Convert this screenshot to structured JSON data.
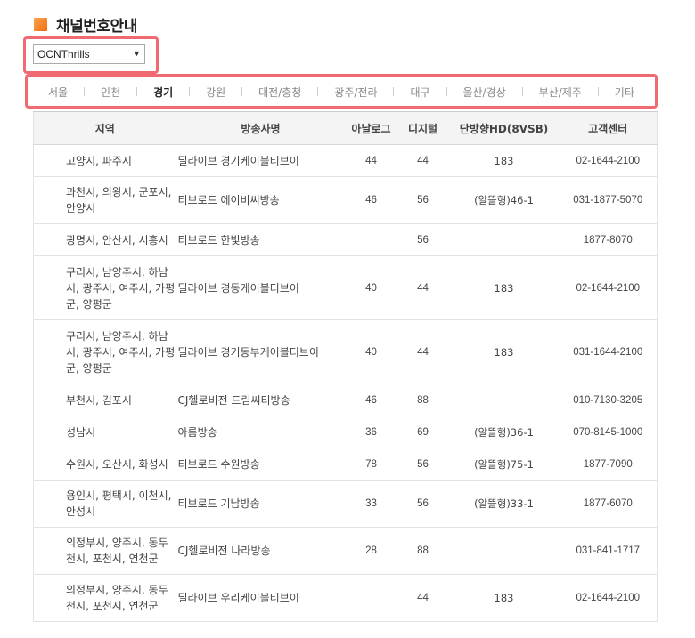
{
  "page": {
    "title": "채널번호안내"
  },
  "channel_select": {
    "selected": "OCNThrills"
  },
  "tabs": [
    {
      "label": "서울",
      "active": false
    },
    {
      "label": "인천",
      "active": false
    },
    {
      "label": "경기",
      "active": true
    },
    {
      "label": "강원",
      "active": false
    },
    {
      "label": "대전/충청",
      "active": false
    },
    {
      "label": "광주/전라",
      "active": false
    },
    {
      "label": "대구",
      "active": false
    },
    {
      "label": "울산/경상",
      "active": false
    },
    {
      "label": "부산/제주",
      "active": false
    },
    {
      "label": "기타",
      "active": false
    }
  ],
  "table": {
    "headers": {
      "region": "지역",
      "station": "방송사명",
      "analog": "아날로그",
      "digital": "디지털",
      "hd": "단방향HD(8VSB)",
      "phone": "고객센터"
    },
    "rows": [
      {
        "region": "고양시, 파주시",
        "station": "딜라이브 경기케이블티브이",
        "analog": "44",
        "digital": "44",
        "hd": "183",
        "phone": "02-1644-2100"
      },
      {
        "region": "과천시, 의왕시, 군포시, 안양시",
        "station": "티브로드 에이비씨방송",
        "analog": "46",
        "digital": "56",
        "hd": "(알뜰형)46-1",
        "phone": "031-1877-5070"
      },
      {
        "region": "광명시, 안산시, 시흥시",
        "station": "티브로드 한빛방송",
        "analog": "",
        "digital": "56",
        "hd": "",
        "phone": "1877-8070"
      },
      {
        "region": "구리시, 남양주시, 하남시, 광주시, 여주시, 가평군, 양평군",
        "station": "딜라이브 경동케이블티브이",
        "analog": "40",
        "digital": "44",
        "hd": "183",
        "phone": "02-1644-2100"
      },
      {
        "region": "구리시, 남양주시, 하남시, 광주시, 여주시, 가평군, 양평군",
        "station": "딜라이브 경기동부케이블티브이",
        "analog": "40",
        "digital": "44",
        "hd": "183",
        "phone": "031-1644-2100"
      },
      {
        "region": "부천시, 김포시",
        "station": "CJ헬로비전 드림씨티방송",
        "analog": "46",
        "digital": "88",
        "hd": "",
        "phone": "010-7130-3205"
      },
      {
        "region": "성남시",
        "station": "아름방송",
        "analog": "36",
        "digital": "69",
        "hd": "(알뜰형)36-1",
        "phone": "070-8145-1000"
      },
      {
        "region": "수원시, 오산시, 화성시",
        "station": "티브로드 수원방송",
        "analog": "78",
        "digital": "56",
        "hd": "(알뜰형)75-1",
        "phone": "1877-7090"
      },
      {
        "region": "용인시, 평택시, 이천시, 안성시",
        "station": "티브로드 기남방송",
        "analog": "33",
        "digital": "56",
        "hd": "(알뜰형)33-1",
        "phone": "1877-6070"
      },
      {
        "region": "의정부시, 양주시, 동두천시, 포천시, 연천군",
        "station": "CJ헬로비전 나라방송",
        "analog": "28",
        "digital": "88",
        "hd": "",
        "phone": "031-841-1717"
      },
      {
        "region": "의정부시, 양주시, 동두천시, 포천시, 연천군",
        "station": "딜라이브 우리케이블티브이",
        "analog": "",
        "digital": "44",
        "hd": "183",
        "phone": "02-1644-2100"
      }
    ]
  },
  "colors": {
    "accent": "#f47a20",
    "highlight": "#f06a72"
  }
}
